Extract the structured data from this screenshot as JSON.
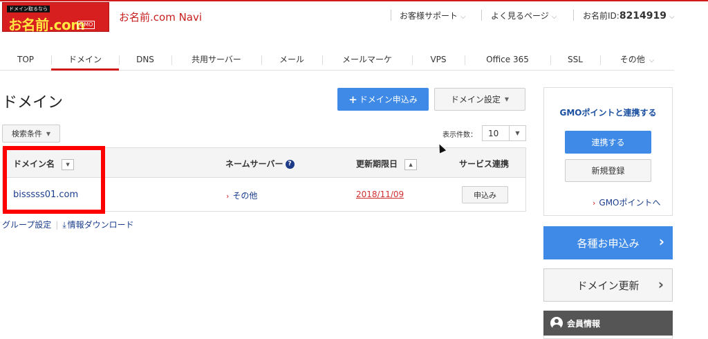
{
  "header": {
    "logo_tag": "ドメイン取るなら",
    "logo_brand": "お名前.com",
    "logo_gmo": "GMO",
    "app_title": "お名前.com Navi",
    "support_label": "お客様サポート",
    "faq_label": "よく見るページ",
    "id_prefix": "お名前ID:",
    "id_value": "8214919"
  },
  "nav": {
    "items": [
      "TOP",
      "ドメイン",
      "DNS",
      "共用サーバー",
      "メール",
      "メールマーケ",
      "VPS",
      "Office 365",
      "SSL",
      "その他"
    ],
    "active": "ドメイン"
  },
  "main": {
    "title": "ドメイン",
    "apply_button": "ドメイン申込み",
    "settings_button": "ドメイン設定",
    "filter_button": "検索条件",
    "count_label": "表示件数：",
    "count_value": "10",
    "table": {
      "headers": [
        "ドメイン名",
        "ネームサーバー",
        "更新期限日",
        "サービス連携"
      ],
      "rows": [
        {
          "domain": "bisssss01.com",
          "nameserver": "その他",
          "expiry": "2018/11/09",
          "action": "申込み"
        }
      ]
    },
    "group_settings": "グループ設定",
    "download_info": "情報ダウンロード"
  },
  "sidebar": {
    "gmo_title": "GMOポイントと連携する",
    "link_button": "連携する",
    "register_button": "新規登録",
    "gmo_points_link": "GMOポイントへ",
    "apply_button": "各種お申込み",
    "renew_button": "ドメイン更新",
    "member_info": "会員情報"
  },
  "colors": {
    "accent_red": "#d01818",
    "primary_blue": "#3e8ae6",
    "link_blue": "#1a3c8c",
    "highlight": "#ff0000"
  },
  "icons": [
    "plus-icon",
    "caret-down-icon",
    "help-icon",
    "sort-icon",
    "download-icon",
    "chevron-right-icon",
    "user-icon",
    "mouse-cursor-icon"
  ]
}
